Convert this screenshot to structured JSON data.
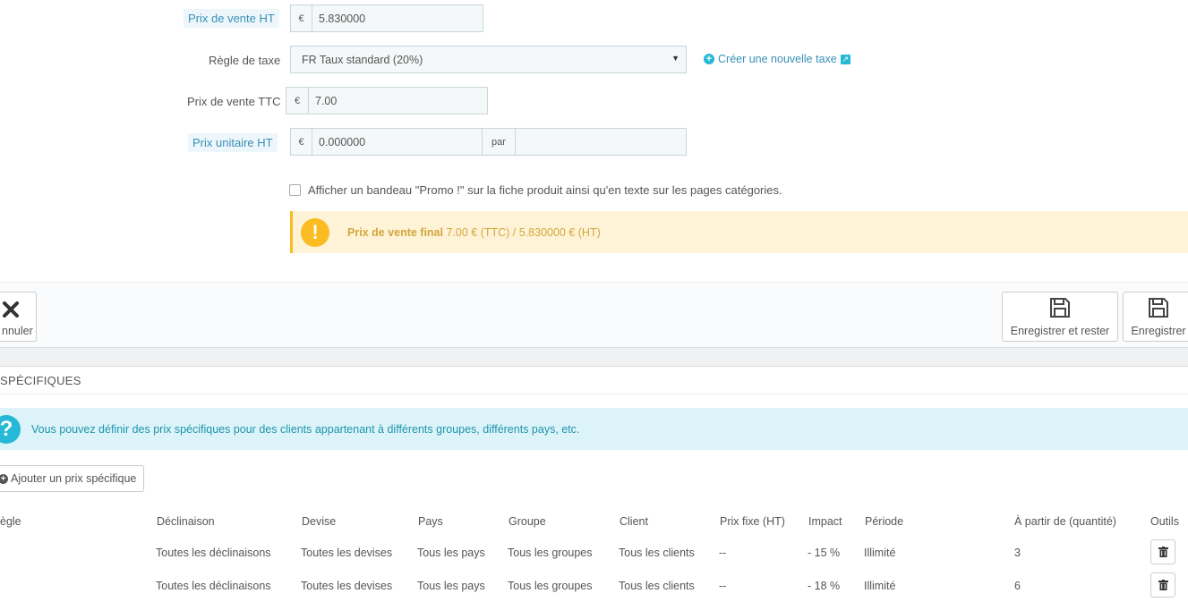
{
  "form": {
    "price_ht": {
      "label": "Prix de vente HT",
      "currency": "€",
      "value": "5.830000"
    },
    "tax_rule": {
      "label": "Règle de taxe",
      "selected": "FR Taux standard (20%)",
      "create_link": "Créer une nouvelle taxe"
    },
    "price_ttc": {
      "label": "Prix de vente TTC",
      "currency": "€",
      "value": "7.00"
    },
    "unit_price": {
      "label": "Prix unitaire HT",
      "currency": "€",
      "value": "0.000000",
      "per_label": "par",
      "unit_value": ""
    },
    "promo_checkbox": {
      "label": "Afficher un bandeau \"Promo !\" sur la fiche produit ainsi qu'en texte sur les pages catégories.",
      "checked": false
    },
    "final_price": {
      "label": "Prix de vente final",
      "value": "7.00 € (TTC) / 5.830000 € (HT)"
    }
  },
  "toolbar": {
    "cancel_label": "nnuler",
    "save_stay_label": "Enregistrer et rester",
    "save_label": "Enregistrer"
  },
  "specific_prices": {
    "title": "SPÉCIFIQUES",
    "info": "Vous pouvez définir des prix spécifiques pour des clients appartenant à différents groupes, différents pays, etc.",
    "add_button": "Ajouter un prix spécifique",
    "columns": [
      "ègle",
      "Déclinaison",
      "Devise",
      "Pays",
      "Groupe",
      "Client",
      "Prix fixe (HT)",
      "Impact",
      "Période",
      "À partir de (quantité)",
      "Outils"
    ],
    "rows": [
      {
        "rule": "",
        "combination": "Toutes les déclinaisons",
        "currency": "Toutes les devises",
        "country": "Tous les pays",
        "group": "Tous les groupes",
        "customer": "Tous les clients",
        "fixed_price": "--",
        "impact": "- 15 %",
        "period": "Illimité",
        "from_qty": "3"
      },
      {
        "rule": "",
        "combination": "Toutes les déclinaisons",
        "currency": "Toutes les devises",
        "country": "Tous les pays",
        "group": "Tous les groupes",
        "customer": "Tous les clients",
        "fixed_price": "--",
        "impact": "- 18 %",
        "period": "Illimité",
        "from_qty": "6"
      }
    ]
  },
  "colors": {
    "accent": "#25b9d7",
    "warning": "#fbbb22",
    "warning_bg": "#fff3d7",
    "info_bg": "#dcf4f9"
  }
}
